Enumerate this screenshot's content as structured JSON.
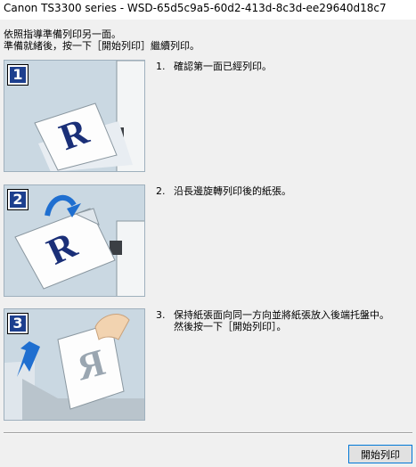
{
  "window": {
    "title": "Canon TS3300 series - WSD-65d5c9a5-60d2-413d-8c3d-ee29640d18c7"
  },
  "intro": {
    "line1": "依照指導準備列印另一面。",
    "line2": "準備就緒後，按一下［開始列印］繼續列印。"
  },
  "steps": [
    {
      "num_label": "1",
      "no": "1.",
      "text_line1": "確認第一面已經列印。",
      "text_line2": ""
    },
    {
      "num_label": "2",
      "no": "2.",
      "text_line1": "沿長邊旋轉列印後的紙張。",
      "text_line2": ""
    },
    {
      "num_label": "3",
      "no": "3.",
      "text_line1": "保持紙張面向同一方向並將紙張放入後端托盤中。",
      "text_line2": "然後按一下［開始列印］。"
    }
  ],
  "illustration_letter": "R",
  "buttons": {
    "start_print": "開始列印"
  },
  "colors": {
    "illustration_bg": "#cad8e2",
    "step_badge": "#1d3f8e",
    "arrow": "#1f6fd0",
    "letter": "#1a2f78"
  }
}
